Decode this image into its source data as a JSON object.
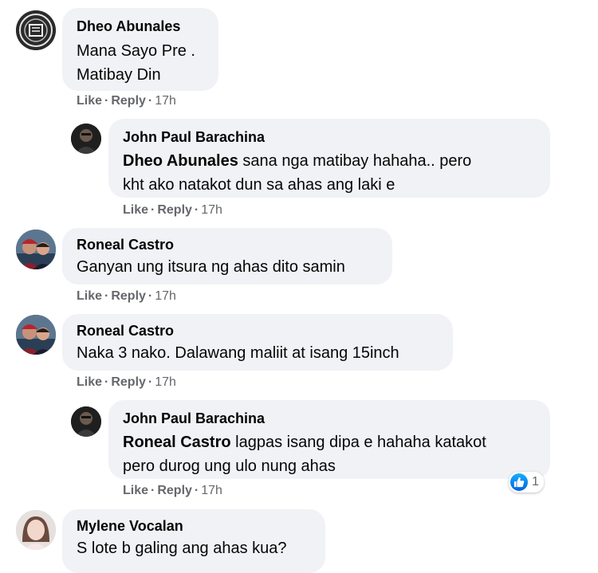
{
  "actions": {
    "like": "Like",
    "reply": "Reply",
    "separator": "·"
  },
  "comments": [
    {
      "author": "Dheo Abunales",
      "lines": [
        "Mana Sayo Pre .",
        "Matibay Din"
      ],
      "time": "17h",
      "avatar": "logo-seal-avatar"
    },
    {
      "author": "John Paul Barachina",
      "mention": "Dheo Abunales",
      "line1_rest": " sana nga matibay hahaha.. pero",
      "line2": "kht ako natakot dun sa ahas ang laki e",
      "time": "17h",
      "avatar": "dark-photo-avatar"
    },
    {
      "author": "Roneal Castro",
      "text": "Ganyan ung itsura ng ahas dito samin",
      "time": "17h",
      "avatar": "couple-photo-avatar"
    },
    {
      "author": "Roneal Castro",
      "text": "Naka 3 nako. Dalawang maliit at isang 15inch",
      "time": "17h",
      "avatar": "couple-photo-avatar"
    },
    {
      "author": "John Paul Barachina",
      "mention": "Roneal Castro",
      "line1_rest": " lagpas isang dipa e hahaha katakot",
      "line2": "pero durog ung ulo nung ahas",
      "time": "17h",
      "avatar": "dark-photo-avatar",
      "reaction_icon": "like-reaction-icon",
      "reaction_count": "1"
    },
    {
      "author": "Mylene Vocalan",
      "text": "S lote b galing ang ahas kua?",
      "avatar": "woman-photo-avatar"
    }
  ],
  "colors": {
    "bubble": "#f0f2f5",
    "meta": "#65676b",
    "text": "#050505",
    "like_blue": "#1877f2"
  }
}
